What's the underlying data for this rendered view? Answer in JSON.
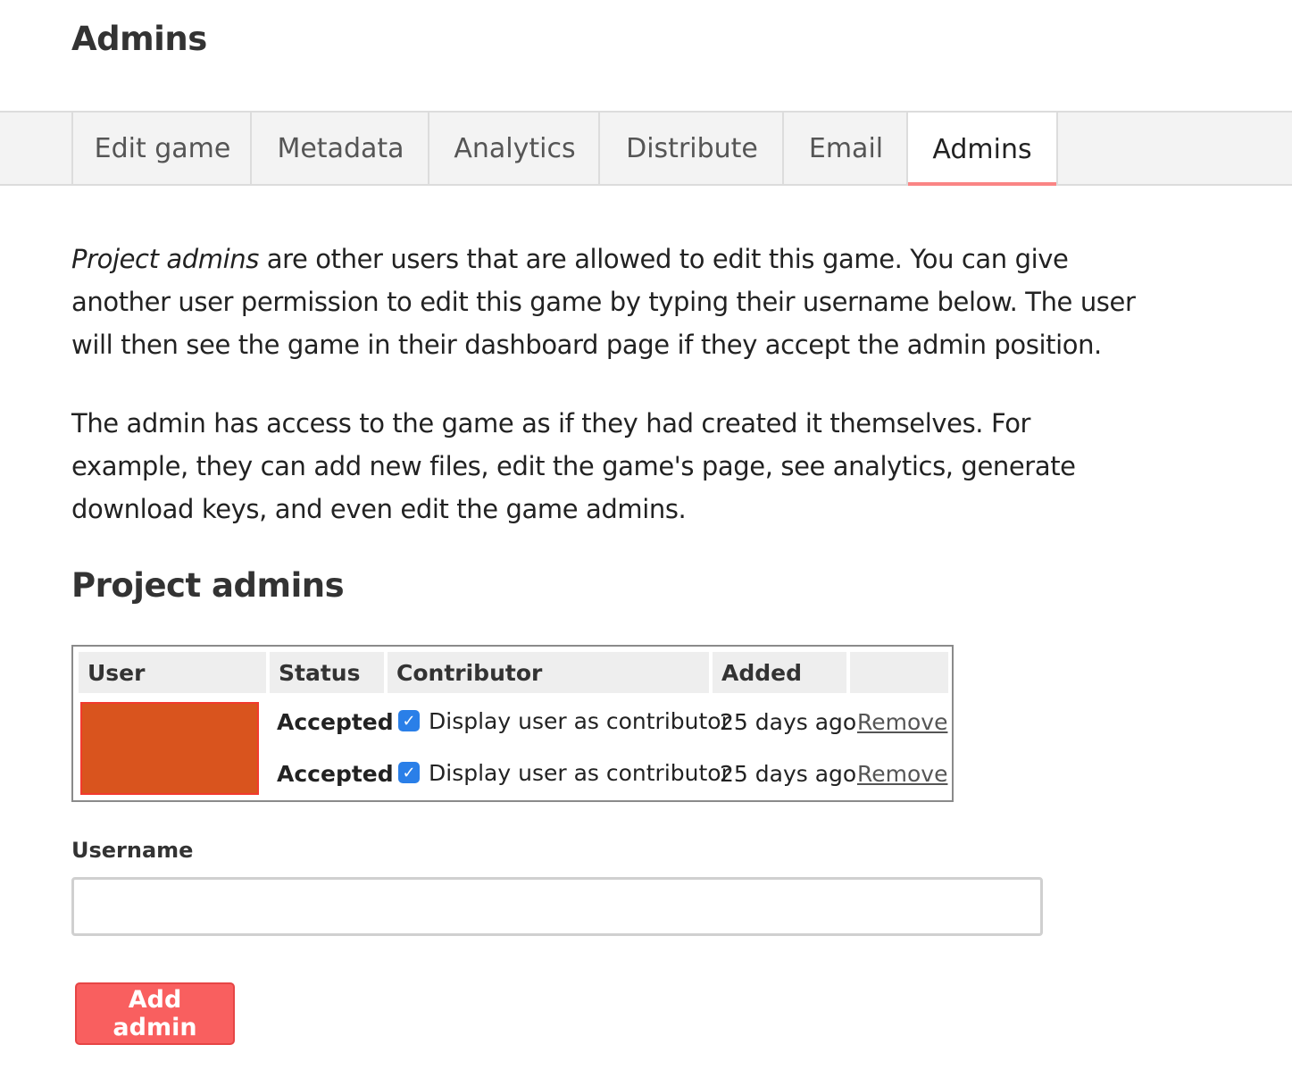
{
  "page": {
    "title": "Admins"
  },
  "tabs": [
    {
      "label": "Edit game",
      "active": false
    },
    {
      "label": "Metadata",
      "active": false
    },
    {
      "label": "Analytics",
      "active": false
    },
    {
      "label": "Distribute",
      "active": false
    },
    {
      "label": "Email",
      "active": false
    },
    {
      "label": "Admins",
      "active": true
    }
  ],
  "intro": {
    "p1_em": "Project admins",
    "p1_rest": " are other users that are allowed to edit this game. You can give another user permission to edit this game by typing their username below. The user will then see the game in their dashboard page if they accept the admin position.",
    "p2": "The admin has access to the game as if they had created it themselves. For example, they can add new files, edit the game's page, see analytics, generate download keys, and even edit the game admins."
  },
  "section": {
    "title": "Project admins"
  },
  "table": {
    "headers": {
      "user": "User",
      "status": "Status",
      "contributor": "Contributor",
      "added": "Added",
      "actions": ""
    },
    "rows": [
      {
        "status": "Accepted",
        "contributor_label": "Display user as contributor",
        "contributor_checked": true,
        "added": "25 days ago",
        "action": "Remove"
      },
      {
        "status": "Accepted",
        "contributor_label": "Display user as contributor",
        "contributor_checked": true,
        "added": "25 days ago",
        "action": "Remove"
      }
    ],
    "redaction_color": "#d9541e"
  },
  "form": {
    "username_label": "Username",
    "username_value": "",
    "username_placeholder": "",
    "submit_label": "Add admin"
  },
  "colors": {
    "accent": "#fa8585",
    "button": "#f95f5f",
    "checkbox": "#2a7fe8"
  },
  "icons": {
    "checkbox": "checkmark-icon"
  }
}
